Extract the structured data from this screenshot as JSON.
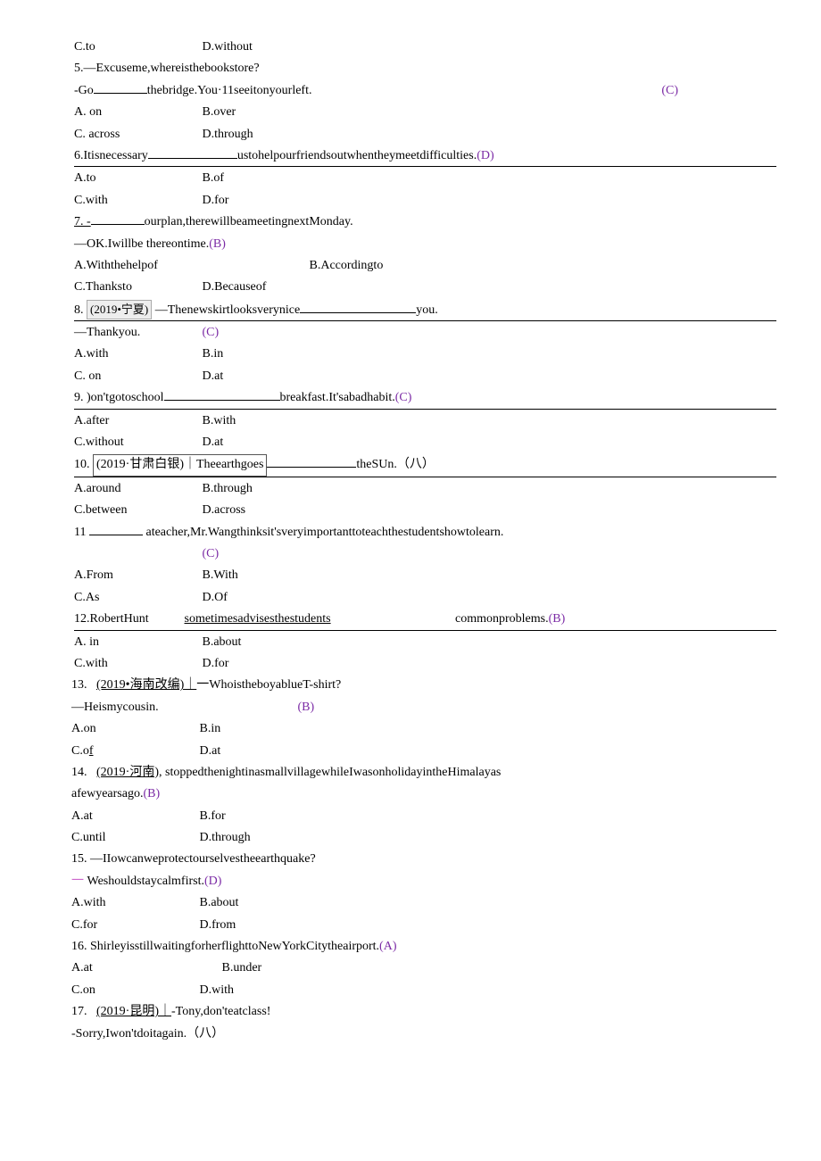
{
  "q4": {
    "c": "C.to",
    "d": "D.without"
  },
  "q5": {
    "line1a": "5.—Excuseme,whereisthebookstore?",
    "line1b": "-Go",
    "line1c": "thebridge.You·11seeitonyourleft.",
    "ans": "(C)",
    "a": "A. on",
    "b": "B.over",
    "c": "C. across",
    "d": "D.through"
  },
  "q6": {
    "stem1": "6.Itisnecessary",
    "stem2": "ustohelpourfriendsoutwhentheymeetdifficulties.",
    "ans": "(D)",
    "a": "A.to",
    "b": "B.of",
    "c": "C.with",
    "d": "D.for"
  },
  "q7": {
    "stem1": "7.   -",
    "stem2": "ourplan,therewillbeameetingnextMonday.",
    "line2": "—OK.Iwillbe      thereontime.",
    "ans": "(B)",
    "a": "A.Withthehelpof",
    "b": "B.Accordingto",
    "c": "C.Thanksto",
    "d": "D.Becauseof"
  },
  "q8": {
    "num": "8.",
    "tag": "(2019•宁夏)",
    "stem1": "—Thenewskirtlooksverynice",
    "stem2": "you.",
    "line2": "—Thankyou.",
    "ans": "(C)",
    "a": "A.with",
    "b": "B.in",
    "c": "C. on",
    "d": "D.at"
  },
  "q9": {
    "stem1": "9.   )on'tgotoschool",
    "stem2": "breakfast.It'sabadhabit.",
    "ans": "(C)",
    "a": "A.after",
    "b": "B.with",
    "c": "C.without",
    "d": "D.at"
  },
  "q10": {
    "num": "10.",
    "box": "(2019·甘肃白银)｜Theearthgoes",
    "stem2": "theSUn.",
    "ans": "（八）",
    "a": "A.around",
    "b": "B.through",
    "c": "C.between",
    "d": "D.across"
  },
  "q11": {
    "num": "11",
    "stem": "ateacher,Mr.Wangthinksit'sveryimportanttoteachthestudentshowtolearn.",
    "ans": "(C)",
    "a": "A.From",
    "b": "B.With",
    "c": "C.As",
    "d": "D.Of"
  },
  "q12": {
    "stem1": "12.RobertHunt",
    "stem2": "sometimesadvisesthestudents",
    "stem3": "commonproblems.",
    "ans": "(B)",
    "a": "A. in",
    "b": "B.about",
    "c": "C.with",
    "d": "D.for"
  },
  "q13": {
    "num": "13.",
    "tag": "(2019•海南改编)｜",
    "stem": "一WhoistheboyablueT-shirt?",
    "line2": "—Heismycousin.",
    "ans": "(B)",
    "a": "A.on",
    "b": "B.in",
    "c": "C.of",
    "d": "D.at"
  },
  "q14": {
    "num": "14.",
    "tag": "(2019·河南),",
    "stem": "stoppedthenightinasmallvillagewhileIwasonholidayintheHimalayas",
    "line2": "afewyearsago.",
    "ans": "(B)",
    "a": "A.at",
    "b": "B.for",
    "c": "C.until",
    "d": "D.through"
  },
  "q15": {
    "stem": "15.   —IIowcanweprotectourselvestheearthquake?",
    "dash": "一",
    "line2": " Weshouldstaycalmfirst.",
    "ans": "(D)",
    "a": "A.with",
    "b": "B.about",
    "c": "C.for",
    "d": "D.from"
  },
  "q16": {
    "stem": "16.   ShirleyisstillwaitingforherflighttoNewYorkCitytheairport.",
    "ans": "(A)",
    "a": "A.at",
    "b": "B.under",
    "c": "C.on",
    "d": "D.with"
  },
  "q17": {
    "num": "17.",
    "tag": "(2019·昆明)｜",
    "stem": "-Tony,don'teatclass!",
    "line2": "-Sorry,Iwon'tdoitagain.",
    "ans": "（八）"
  }
}
